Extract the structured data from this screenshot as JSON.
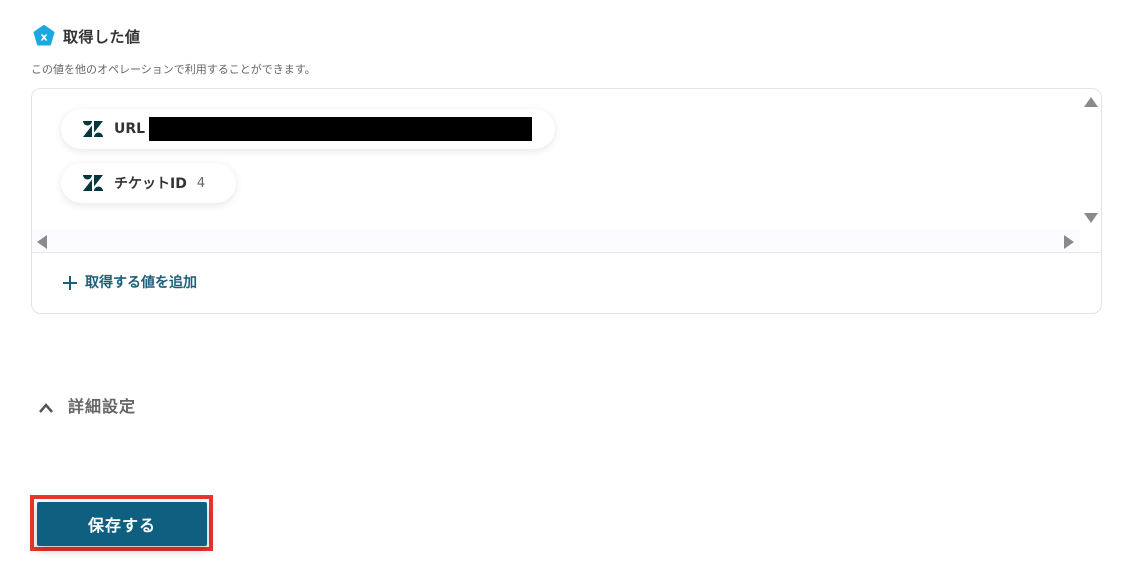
{
  "section": {
    "title": "取得した値",
    "description": "この値を他のオペレーションで利用することができます。",
    "icon": "yoom-badge-icon"
  },
  "values": [
    {
      "label": "URL",
      "value": "",
      "redacted": true,
      "icon": "zendesk-icon"
    },
    {
      "label": "チケットID",
      "value": "4",
      "redacted": false,
      "icon": "zendesk-icon"
    }
  ],
  "add_value": {
    "label": "取得する値を追加",
    "icon": "plus-icon"
  },
  "advanced": {
    "label": "詳細設定",
    "icon": "chevron-up-icon",
    "expanded": true
  },
  "save_button": {
    "label": "保存する"
  },
  "colors": {
    "accent": "#0e5f80",
    "link": "#1e5f78",
    "highlight": "#e8372a",
    "badge": "#1aa8e0",
    "zendesk": "#03363d"
  }
}
